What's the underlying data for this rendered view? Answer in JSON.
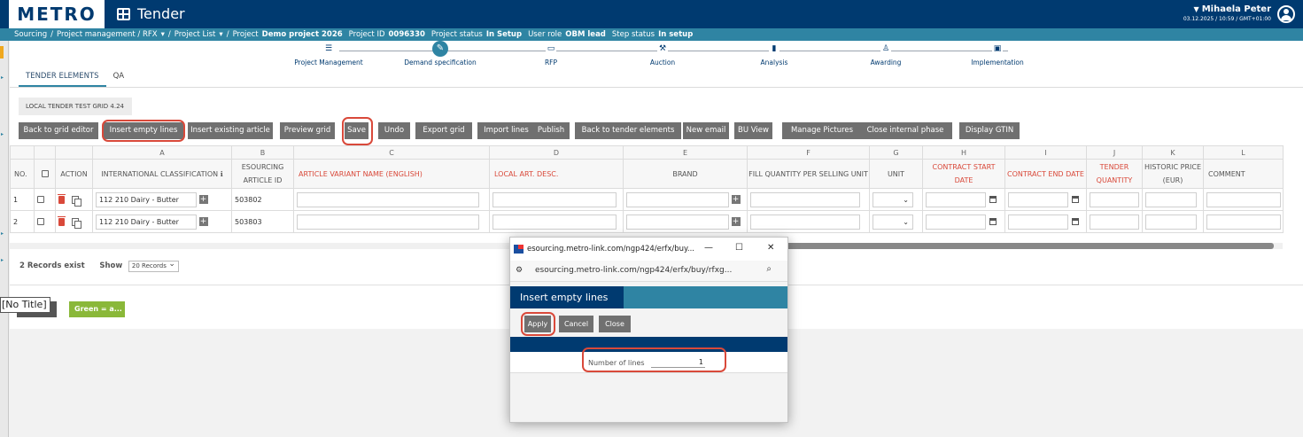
{
  "header": {
    "logo": "METRO",
    "app_title": "Tender",
    "user_name": "Mihaela Peter",
    "user_meta": "03.12.2025 / 10:59 / GMT+01:00"
  },
  "breadcrumb": {
    "items": [
      "Sourcing",
      "/",
      "Project management / RFX",
      "/",
      "Project List",
      "/"
    ],
    "project_label": "Project",
    "project_name": "Demo project 2026",
    "project_id_label": "Project ID",
    "project_id": "0096330",
    "project_status_label": "Project status",
    "project_status": "In Setup",
    "user_role_label": "User role",
    "user_role": "OBM lead",
    "step_status_label": "Step status",
    "step_status": "In setup"
  },
  "stepper": {
    "steps": [
      {
        "label": "Project Management",
        "icon": "list-icon"
      },
      {
        "label": "Demand specification",
        "icon": "pencil-icon",
        "active": true
      },
      {
        "label": "RFP",
        "icon": "document-check-icon"
      },
      {
        "label": "Auction",
        "icon": "gavel-icon"
      },
      {
        "label": "Analysis",
        "icon": "bar-chart-icon"
      },
      {
        "label": "Awarding",
        "icon": "award-icon"
      },
      {
        "label": "Implementation",
        "icon": "calendar-icon"
      }
    ]
  },
  "tabs": [
    {
      "label": "TENDER ELEMENTS",
      "active": true
    },
    {
      "label": "QA",
      "active": false
    }
  ],
  "grid_label": "LOCAL TENDER TEST GRID 4.24",
  "toolbar": {
    "buttons": [
      "Back to grid editor",
      "Insert empty lines",
      "Insert existing article",
      "Preview grid",
      "Save",
      "Undo",
      "Export grid",
      "Import lines",
      "Publish",
      "Back to tender elements",
      "New email",
      "BU View",
      "Manage Pictures",
      "Close internal phase",
      "Display GTIN"
    ]
  },
  "table": {
    "letters": [
      "",
      "",
      "",
      "A",
      "B",
      "C",
      "D",
      "E",
      "F",
      "G",
      "H",
      "I",
      "J",
      "K",
      "L"
    ],
    "headers": [
      "NO.",
      "",
      "ACTION",
      "INTERNATIONAL CLASSIFICATION",
      "ESOURCING ARTICLE ID",
      "ARTICLE VARIANT NAME (ENGLISH)",
      "LOCAL ART. DESC.",
      "BRAND",
      "FILL QUANTITY PER SELLING UNIT",
      "UNIT",
      "CONTRACT START DATE",
      "CONTRACT END DATE",
      "TENDER QUANTITY",
      "HISTORIC PRICE (EUR)",
      "COMMENT"
    ],
    "rows": [
      {
        "no": "1",
        "classification": "112 210 Dairy - Butter",
        "article_id": "503802"
      },
      {
        "no": "2",
        "classification": "112 210 Dairy - Butter",
        "article_id": "503803"
      }
    ]
  },
  "records": {
    "count_text": "2 Records exist",
    "show_label": "Show",
    "page_size": "20 Records"
  },
  "legend": {
    "green_label": "Green = a..."
  },
  "tooltip": "[No Title]",
  "popup": {
    "window_title": "esourcing.metro-link.com/ngp424/erfx/buy...",
    "url": "esourcing.metro-link.com/ngp424/erfx/buy/rfxg...",
    "heading": "Insert empty lines",
    "buttons": [
      "Apply",
      "Cancel",
      "Close"
    ],
    "lines_label": "Number of lines",
    "lines_value": "1"
  },
  "colors": {
    "header_bg": "#003a70",
    "accent": "#2f84a3",
    "highlight": "#d9493a",
    "button_bg": "#707070",
    "legend_green": "#8ab839"
  }
}
